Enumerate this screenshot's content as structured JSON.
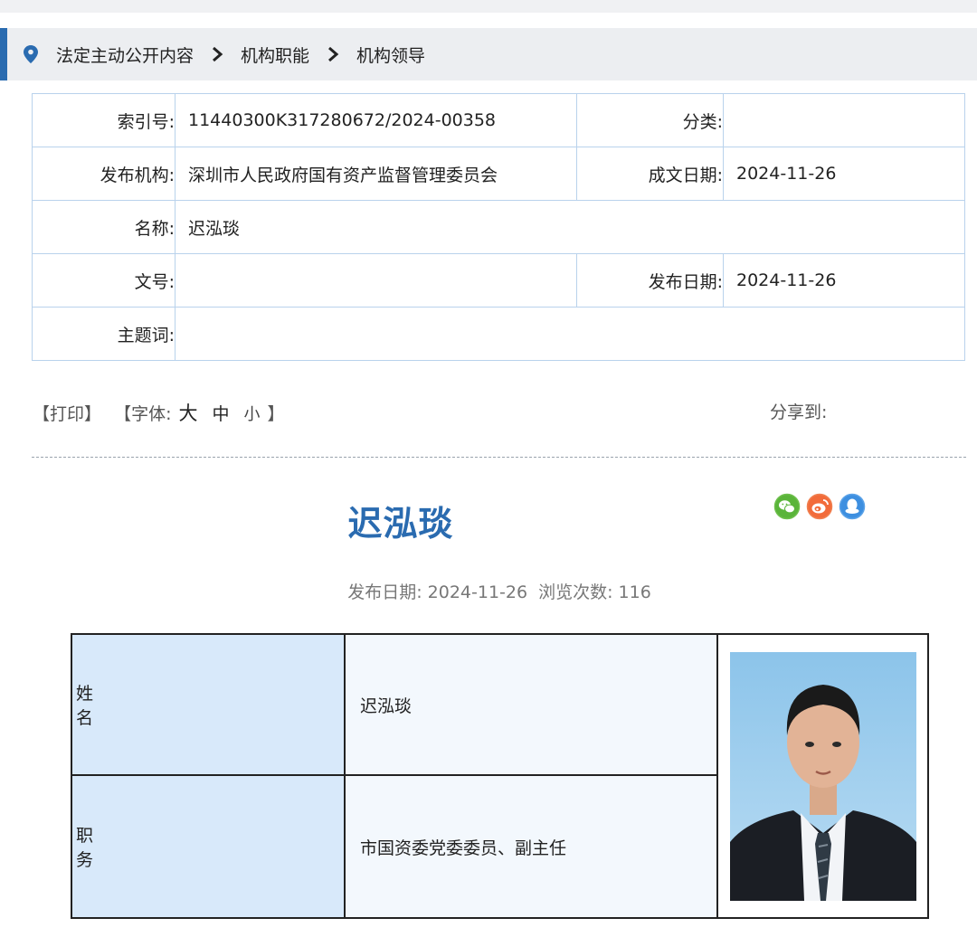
{
  "breadcrumb": {
    "items": [
      "法定主动公开内容",
      "机构职能",
      "机构领导"
    ]
  },
  "meta": {
    "index_label": "索引号:",
    "index_value": "11440300K317280672/2024-00358",
    "category_label": "分类:",
    "category_value": "",
    "publisher_label": "发布机构:",
    "publisher_value": "深圳市人民政府国有资产监督管理委员会",
    "written_date_label": "成文日期:",
    "written_date_value": "2024-11-26",
    "name_label": "名称:",
    "name_value": "迟泓琰",
    "doc_no_label": "文号:",
    "doc_no_value": "",
    "publish_date_label": "发布日期:",
    "publish_date_value": "2024-11-26",
    "keywords_label": "主题词:",
    "keywords_value": ""
  },
  "tools": {
    "print": "【打印】",
    "font_prefix": "【字体:",
    "font_large": "大",
    "font_medium": "中",
    "font_small": "小",
    "font_suffix": "】",
    "share_label": "分享到:"
  },
  "share_icons": [
    "wechat-icon",
    "weibo-icon",
    "qq-icon"
  ],
  "article": {
    "title": "迟泓琰",
    "publish_date": "发布日期: 2024-11-26",
    "views": "浏览次数: 116"
  },
  "profile": {
    "name_header": "姓名",
    "name_value": "迟泓琰",
    "position_header": "职务",
    "position_value": "市国资委党委委员、副主任"
  },
  "colors": {
    "accent": "#2a6bb0",
    "table_border": "#b9d2ec",
    "header_cell": "#d8e9fa"
  }
}
